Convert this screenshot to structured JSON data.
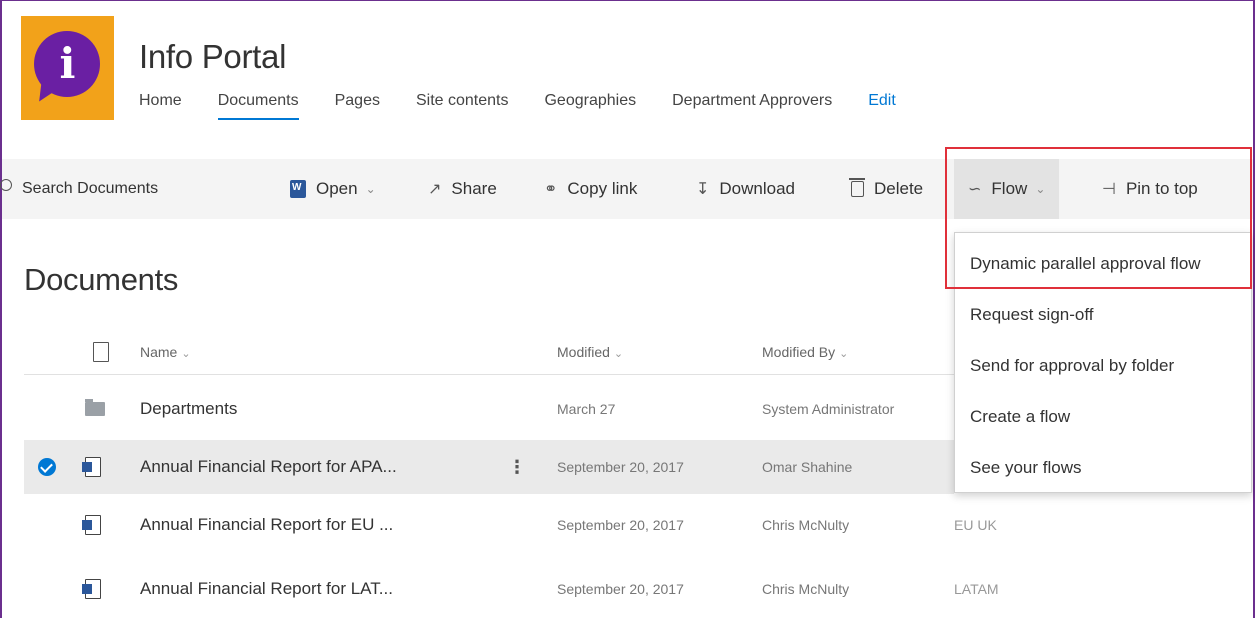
{
  "site": {
    "logo_letter": "i",
    "title": "Info Portal"
  },
  "nav": {
    "items": [
      "Home",
      "Documents",
      "Pages",
      "Site contents",
      "Geographies",
      "Department Approvers"
    ],
    "edit": "Edit",
    "active": "Documents"
  },
  "commandbar": {
    "search_label": "Search Documents",
    "open": "Open",
    "share": "Share",
    "copy_link": "Copy link",
    "download": "Download",
    "delete": "Delete",
    "flow": "Flow",
    "pin_to_top": "Pin to top"
  },
  "page_title": "Documents",
  "columns": {
    "name": "Name",
    "modified": "Modified",
    "modified_by": "Modified By"
  },
  "rows": [
    {
      "name": "Departments",
      "modified": "March 27",
      "modified_by": "System Administrator",
      "geography": ""
    },
    {
      "name": "Annual Financial Report for APA...",
      "modified": "September 20, 2017",
      "modified_by": "Omar Shahine",
      "geography": ""
    },
    {
      "name": "Annual Financial Report for EU ...",
      "modified": "September 20, 2017",
      "modified_by": "Chris McNulty",
      "geography": "EU UK"
    },
    {
      "name": "Annual Financial Report for LAT...",
      "modified": "September 20, 2017",
      "modified_by": "Chris McNulty",
      "geography": "LATAM"
    }
  ],
  "flow_menu": {
    "items": [
      "Dynamic parallel approval flow",
      "Request sign-off",
      "Send for approval by folder",
      "Create a flow",
      "See your flows"
    ]
  },
  "colors": {
    "accent": "#0078d4",
    "logo_bg": "#f2a21a",
    "logo_bubble": "#6a1fa3",
    "highlight": "#e0303a"
  }
}
